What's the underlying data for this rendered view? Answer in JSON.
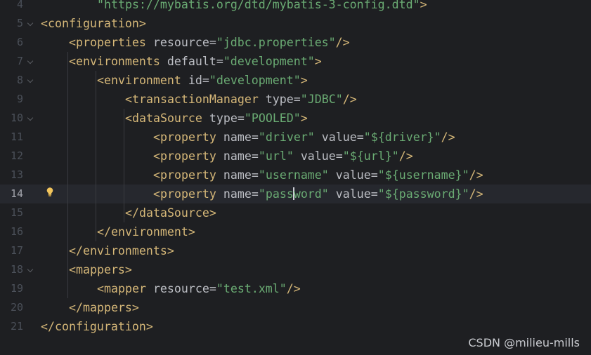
{
  "editor": {
    "current_line_number": "14",
    "lines": [
      {
        "num": "4",
        "fold": false,
        "tokens": [
          {
            "cls": "t-val",
            "text": "\"https://mybatis.org/dtd/mybatis-3-config.dtd\""
          },
          {
            "cls": "t-tag",
            "text": ">"
          }
        ]
      },
      {
        "num": "5",
        "fold": true,
        "tokens": [
          {
            "cls": "t-tag",
            "text": "<configuration>"
          }
        ]
      },
      {
        "num": "6",
        "fold": false,
        "tokens": [
          {
            "cls": "t-tag",
            "text": "<properties "
          },
          {
            "cls": "t-attr",
            "text": "resource"
          },
          {
            "cls": "t-eq",
            "text": "="
          },
          {
            "cls": "t-val",
            "text": "\"jdbc.properties\""
          },
          {
            "cls": "t-tag",
            "text": "/>"
          }
        ]
      },
      {
        "num": "7",
        "fold": true,
        "tokens": [
          {
            "cls": "t-tag",
            "text": "<environments "
          },
          {
            "cls": "t-attr",
            "text": "default"
          },
          {
            "cls": "t-eq",
            "text": "="
          },
          {
            "cls": "t-val",
            "text": "\"development\""
          },
          {
            "cls": "t-tag",
            "text": ">"
          }
        ]
      },
      {
        "num": "8",
        "fold": true,
        "tokens": [
          {
            "cls": "t-tag",
            "text": "<environment "
          },
          {
            "cls": "t-attr",
            "text": "id"
          },
          {
            "cls": "t-eq",
            "text": "="
          },
          {
            "cls": "t-val",
            "text": "\"development\""
          },
          {
            "cls": "t-tag",
            "text": ">"
          }
        ]
      },
      {
        "num": "9",
        "fold": false,
        "tokens": [
          {
            "cls": "t-tag",
            "text": "<transactionManager "
          },
          {
            "cls": "t-attr",
            "text": "type"
          },
          {
            "cls": "t-eq",
            "text": "="
          },
          {
            "cls": "t-val",
            "text": "\"JDBC\""
          },
          {
            "cls": "t-tag",
            "text": "/>"
          }
        ]
      },
      {
        "num": "10",
        "fold": true,
        "tokens": [
          {
            "cls": "t-tag",
            "text": "<dataSource "
          },
          {
            "cls": "t-attr",
            "text": "type"
          },
          {
            "cls": "t-eq",
            "text": "="
          },
          {
            "cls": "t-val",
            "text": "\"POOLED\""
          },
          {
            "cls": "t-tag",
            "text": ">"
          }
        ]
      },
      {
        "num": "11",
        "fold": false,
        "tokens": [
          {
            "cls": "t-tag",
            "text": "<property "
          },
          {
            "cls": "t-attr",
            "text": "name"
          },
          {
            "cls": "t-eq",
            "text": "="
          },
          {
            "cls": "t-val",
            "text": "\"driver\""
          },
          {
            "cls": "t-attr",
            "text": " value"
          },
          {
            "cls": "t-eq",
            "text": "="
          },
          {
            "cls": "t-val",
            "text": "\"${driver}\""
          },
          {
            "cls": "t-tag",
            "text": "/>"
          }
        ]
      },
      {
        "num": "12",
        "fold": false,
        "tokens": [
          {
            "cls": "t-tag",
            "text": "<property "
          },
          {
            "cls": "t-attr",
            "text": "name"
          },
          {
            "cls": "t-eq",
            "text": "="
          },
          {
            "cls": "t-val",
            "text": "\"url\""
          },
          {
            "cls": "t-attr",
            "text": " value"
          },
          {
            "cls": "t-eq",
            "text": "="
          },
          {
            "cls": "t-val",
            "text": "\"${url}\""
          },
          {
            "cls": "t-tag",
            "text": "/>"
          }
        ]
      },
      {
        "num": "13",
        "fold": false,
        "tokens": [
          {
            "cls": "t-tag",
            "text": "<property "
          },
          {
            "cls": "t-attr",
            "text": "name"
          },
          {
            "cls": "t-eq",
            "text": "="
          },
          {
            "cls": "t-val",
            "text": "\"username\""
          },
          {
            "cls": "t-attr",
            "text": " value"
          },
          {
            "cls": "t-eq",
            "text": "="
          },
          {
            "cls": "t-val",
            "text": "\"${username}\""
          },
          {
            "cls": "t-tag",
            "text": "/>"
          }
        ]
      },
      {
        "num": "14",
        "fold": false,
        "current": true,
        "bulb": true,
        "tokens": [
          {
            "cls": "t-tag",
            "text": "<property "
          },
          {
            "cls": "t-attr",
            "text": "name"
          },
          {
            "cls": "t-eq",
            "text": "="
          },
          {
            "cls": "t-val",
            "text": "\"pass"
          },
          {
            "caret": true
          },
          {
            "cls": "t-val",
            "text": "word\""
          },
          {
            "cls": "t-attr",
            "text": " value"
          },
          {
            "cls": "t-eq",
            "text": "="
          },
          {
            "cls": "t-val",
            "text": "\"${password}\""
          },
          {
            "cls": "t-tag",
            "text": "/>"
          }
        ]
      },
      {
        "num": "15",
        "fold": false,
        "tokens": [
          {
            "cls": "t-tag",
            "text": "</dataSource>"
          }
        ]
      },
      {
        "num": "16",
        "fold": false,
        "tokens": [
          {
            "cls": "t-tag",
            "text": "</environment>"
          }
        ]
      },
      {
        "num": "17",
        "fold": false,
        "tokens": [
          {
            "cls": "t-tag",
            "text": "</environments>"
          }
        ]
      },
      {
        "num": "18",
        "fold": true,
        "tokens": [
          {
            "cls": "t-tag",
            "text": "<mappers>"
          }
        ]
      },
      {
        "num": "19",
        "fold": false,
        "tokens": [
          {
            "cls": "t-tag",
            "text": "<mapper "
          },
          {
            "cls": "t-attr",
            "text": "resource"
          },
          {
            "cls": "t-eq",
            "text": "="
          },
          {
            "cls": "t-val",
            "text": "\"test.xml\""
          },
          {
            "cls": "t-tag",
            "text": "/>"
          }
        ]
      },
      {
        "num": "20",
        "fold": false,
        "tokens": [
          {
            "cls": "t-tag",
            "text": "</mappers>"
          }
        ]
      },
      {
        "num": "21",
        "fold": false,
        "tokens": [
          {
            "cls": "t-tag",
            "text": "</configuration>"
          }
        ]
      }
    ]
  },
  "watermark": "CSDN @milieu-mills",
  "colors": {
    "background": "#1e1f22",
    "current_line": "#26282e",
    "tag": "#d5b778",
    "attribute": "#bcbec4",
    "string": "#6aab73",
    "line_number": "#4b5059",
    "bulb": "#f2c55c"
  },
  "icons": [
    "fold-arrow-icon",
    "lightbulb-icon"
  ]
}
